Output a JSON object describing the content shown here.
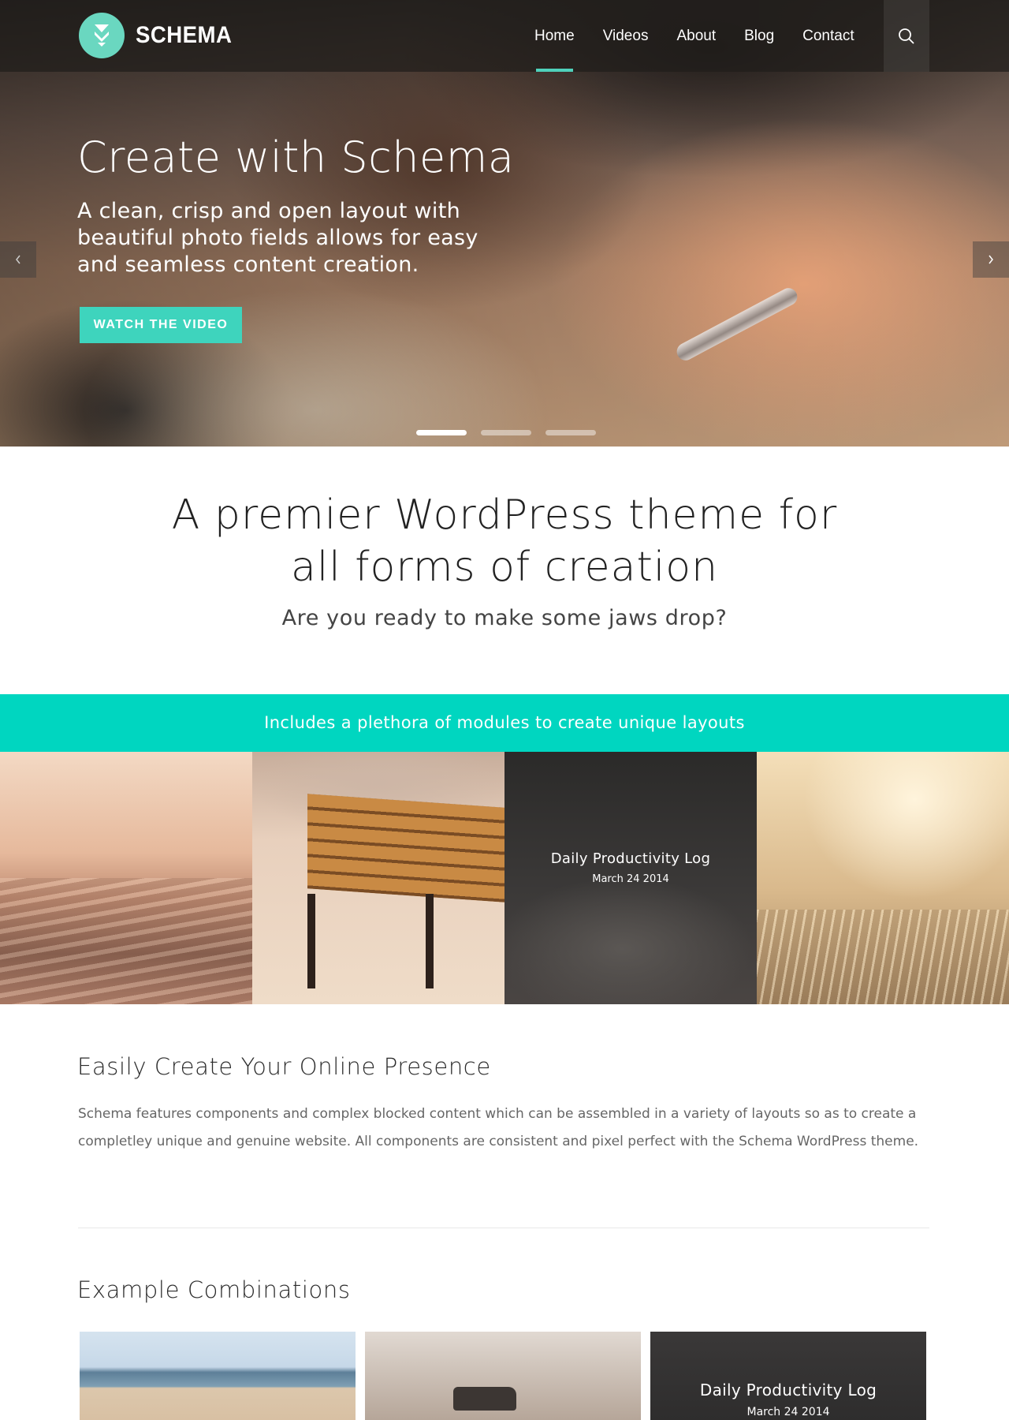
{
  "brand": {
    "name": "SCHEMA",
    "accent": "#3ed4bd"
  },
  "nav": {
    "items": [
      {
        "label": "Home",
        "active": true
      },
      {
        "label": "Videos",
        "active": false
      },
      {
        "label": "About",
        "active": false
      },
      {
        "label": "Blog",
        "active": false
      },
      {
        "label": "Contact",
        "active": false
      }
    ],
    "search_icon": "search-icon"
  },
  "hero": {
    "title": "Create with Schema",
    "subtitle": "A clean, crisp and open layout with beautiful photo fields allows for easy and seamless content creation.",
    "button_label": "WATCH THE VIDEO",
    "prev_icon": "chevron-left-icon",
    "next_icon": "chevron-right-icon",
    "slides": {
      "count": 3,
      "active_index": 0
    }
  },
  "intro": {
    "title": "A premier WordPress theme for all forms of creation",
    "subtitle": "Are you ready to make some jaws drop?"
  },
  "banner": {
    "text": "Includes a plethora of modules to create unique layouts",
    "color": "#00d6c0"
  },
  "gallery": {
    "tiles": [
      {
        "caption_title": "",
        "caption_date": ""
      },
      {
        "caption_title": "",
        "caption_date": ""
      },
      {
        "caption_title": "Daily Productivity Log",
        "caption_date": "March 24 2014"
      },
      {
        "caption_title": "",
        "caption_date": ""
      }
    ]
  },
  "presence": {
    "title": "Easily Create Your Online Presence",
    "body": "Schema features components and complex blocked content which can be assembled in a variety of layouts so as to create a completley unique and genuine website. All components are consistent and pixel perfect with the Schema WordPress theme."
  },
  "combinations": {
    "title": "Example Combinations",
    "cards": [
      {
        "caption_title": "",
        "caption_date": ""
      },
      {
        "caption_title": "",
        "caption_date": ""
      },
      {
        "caption_title": "Daily Productivity Log",
        "caption_date": "March 24 2014"
      }
    ]
  }
}
